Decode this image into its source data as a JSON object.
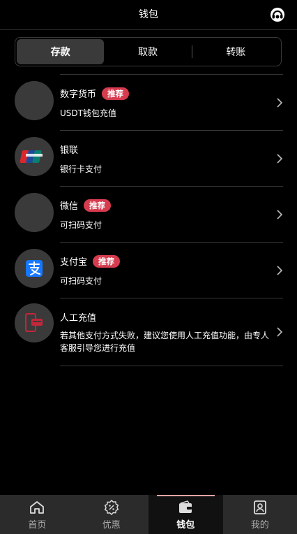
{
  "header": {
    "title": "钱包",
    "support_icon": "headset-icon"
  },
  "segment": {
    "tabs": [
      {
        "label": "存款",
        "active": true
      },
      {
        "label": "取款",
        "active": false
      },
      {
        "label": "转账",
        "active": false
      }
    ]
  },
  "methods": [
    {
      "title": "数字货币",
      "badge": "推荐",
      "subtitle": "USDT钱包充值",
      "icon": "crypto-icon"
    },
    {
      "title": "银联",
      "badge": "",
      "subtitle": "银行卡支付",
      "icon": "unionpay-icon"
    },
    {
      "title": "微信",
      "badge": "推荐",
      "subtitle": "可扫码支付",
      "icon": "wechat-icon"
    },
    {
      "title": "支付宝",
      "badge": "推荐",
      "subtitle": "可扫码支付",
      "icon": "alipay-icon"
    },
    {
      "title": "人工充值",
      "badge": "",
      "subtitle": "若其他支付方式失败，建议您使用人工充值功能，由专人客服引导您进行充值",
      "icon": "manual-recharge-icon"
    }
  ],
  "tabbar": {
    "items": [
      {
        "label": "首页",
        "icon": "home-icon",
        "active": false
      },
      {
        "label": "优惠",
        "icon": "discount-icon",
        "active": false
      },
      {
        "label": "钱包",
        "icon": "wallet-icon",
        "active": true
      },
      {
        "label": "我的",
        "icon": "profile-icon",
        "active": false
      }
    ]
  },
  "colors": {
    "background": "#000000",
    "badge": "#d63b4e",
    "tabbar": "#2b2b2b",
    "alipay_blue": "#1677ff"
  }
}
